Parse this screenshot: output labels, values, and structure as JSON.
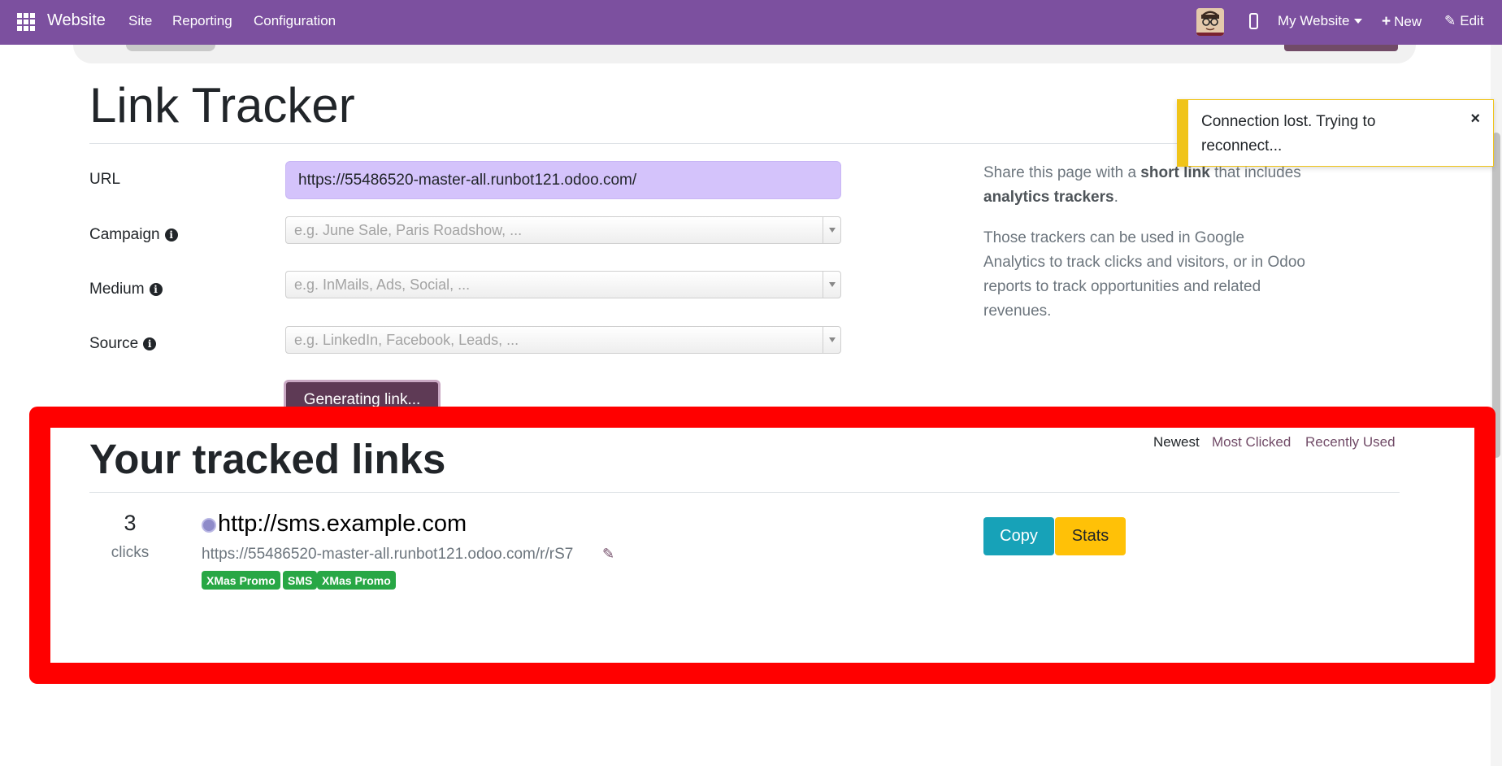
{
  "navbar": {
    "brand": "Website",
    "menu": [
      "Site",
      "Reporting",
      "Configuration"
    ],
    "website_switcher": "My Website",
    "new_label": "New",
    "edit_label": "Edit"
  },
  "page": {
    "title": "Link Tracker"
  },
  "form": {
    "url_label": "URL",
    "url_value": "https://55486520-master-all.runbot121.odoo.com/",
    "campaign_label": "Campaign",
    "campaign_placeholder": "e.g. June Sale, Paris Roadshow, ...",
    "medium_label": "Medium",
    "medium_placeholder": "e.g. InMails, Ads, Social, ...",
    "source_label": "Source",
    "source_placeholder": "e.g. LinkedIn, Facebook, Leads, ...",
    "generate_button": "Generating link..."
  },
  "description": {
    "p1_pre": "Share this page with a ",
    "p1_bold1": "short link",
    "p1_mid": " that includes ",
    "p1_bold2": "analytics trackers",
    "p1_post": ".",
    "p2": "Those trackers can be used in Google Analytics to track clicks and visitors, or in Odoo reports to track opportunities and related revenues."
  },
  "toast": {
    "message": "Connection lost. Trying to reconnect...",
    "close": "×"
  },
  "tracked": {
    "title": "Your tracked links",
    "filters": [
      "Newest",
      "Most Clicked",
      "Recently Used"
    ],
    "links": [
      {
        "clicks": "3",
        "clicks_label": "clicks",
        "title": "http://sms.example.com",
        "short_url": "https://55486520-master-all.runbot121.odoo.com/r/rS7",
        "tags": [
          "XMas Promo",
          "SMS",
          "XMas Promo"
        ],
        "copy_label": "Copy",
        "stats_label": "Stats"
      }
    ]
  },
  "colors": {
    "navbar": "#7c509f",
    "accent": "#714b67",
    "highlight_frame": "#ff0000",
    "tag": "#28a745",
    "copy": "#17a2b8",
    "stats": "#ffc107",
    "toast_border": "#f0c419"
  }
}
